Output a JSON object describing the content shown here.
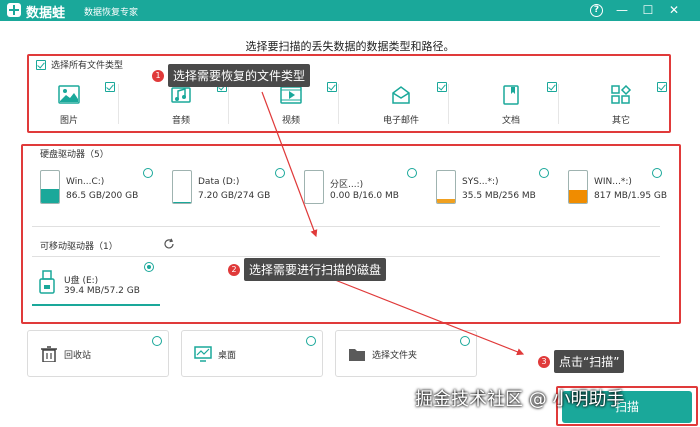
{
  "app": {
    "name": "数据蛙",
    "subtitle": "数据恢复专家"
  },
  "window_controls": {
    "help": "?",
    "minimize": "—",
    "maximize": "☐",
    "close": "✕"
  },
  "instruction": "选择要扫描的丢失数据的数据类型和路径。",
  "file_types": {
    "select_all_label": "选择所有文件类型",
    "items": [
      {
        "label": "图片",
        "icon": "image-icon"
      },
      {
        "label": "音频",
        "icon": "audio-icon"
      },
      {
        "label": "视频",
        "icon": "video-icon"
      },
      {
        "label": "电子邮件",
        "icon": "email-icon"
      },
      {
        "label": "文档",
        "icon": "document-icon"
      },
      {
        "label": "其它",
        "icon": "other-icon"
      }
    ]
  },
  "hard_drives": {
    "title": "硬盘驱动器（5）",
    "items": [
      {
        "name": "Win...C:)",
        "size": "86.5 GB/200 GB",
        "fill": 0.43,
        "color": "#1aa89a"
      },
      {
        "name": "Data (D:)",
        "size": "7.20 GB/274 GB",
        "fill": 0.03,
        "color": "#1aa89a"
      },
      {
        "name": "分区...:)",
        "size": "0.00  B/16.0 MB",
        "fill": 0.0,
        "color": "#1aa89a"
      },
      {
        "name": "SYS...*:)",
        "size": "35.5 MB/256 MB",
        "fill": 0.14,
        "color": "#f0a020"
      },
      {
        "name": "WIN...*:)",
        "size": "817 MB/1.95 GB",
        "fill": 0.42,
        "color": "#f08c00"
      }
    ]
  },
  "removable": {
    "title": "可移动驱动器（1）",
    "items": [
      {
        "name": "U盘 (E:)",
        "size": "39.4 MB/57.2 GB"
      }
    ]
  },
  "locations": [
    {
      "label": "回收站",
      "icon": "recycle-bin-icon"
    },
    {
      "label": "桌面",
      "icon": "desktop-icon"
    },
    {
      "label": "选择文件夹",
      "icon": "folder-icon"
    }
  ],
  "annotations": {
    "step1": {
      "num": "1",
      "text": "选择需要恢复的文件类型"
    },
    "step2": {
      "num": "2",
      "text": "选择需要进行扫描的磁盘"
    },
    "step3": {
      "num": "3",
      "text": "点击“扫描”"
    }
  },
  "scan_button": "扫描",
  "watermark": "掘金技术社区 @ 小明助手",
  "colors": {
    "accent": "#1aa89a",
    "highlight": "#e03a3a"
  }
}
